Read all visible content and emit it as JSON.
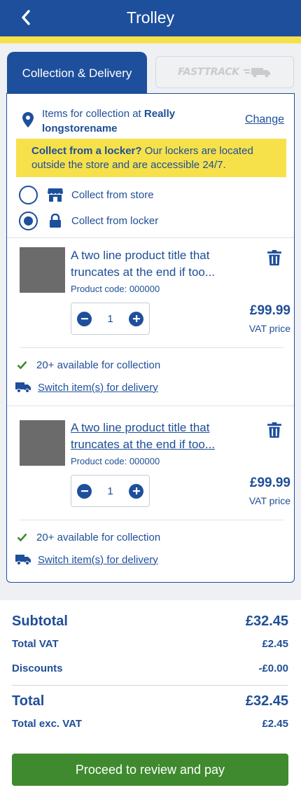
{
  "header": {
    "title": "Trolley"
  },
  "tabs": {
    "active_label": "Collection & Delivery",
    "fast_track_label": "FASTTRACK"
  },
  "location": {
    "prefix": "Items for collection at ",
    "store_name": "Really longstorename",
    "change_label": "Change"
  },
  "locker_banner": {
    "bold": "Collect from a locker?",
    "text": " Our lockers are located outside the store and are accessible 24/7."
  },
  "collect_options": [
    {
      "label": "Collect from store",
      "selected": false,
      "icon": "store-icon"
    },
    {
      "label": "Collect from locker",
      "selected": true,
      "icon": "lock-icon"
    }
  ],
  "products": [
    {
      "title_line1": "A two line product title that",
      "title_line2": "truncates at the end if too...",
      "code": "Product code: 000000",
      "quantity": "1",
      "price": "£99.99",
      "price_note": "VAT price",
      "availability": "20+ available for collection",
      "switch_label": "Switch item(s) for delivery"
    },
    {
      "title_line1": "A two line product title that",
      "title_line2": "truncates at the end if too...",
      "code": "Product code: 000000",
      "quantity": "1",
      "price": "£99.99",
      "price_note": "VAT price",
      "availability": "20+ available for collection",
      "switch_label": "Switch item(s) for delivery"
    }
  ],
  "summary": {
    "subtotal_label": "Subtotal",
    "subtotal_value": "£32.45",
    "vat_label": "Total VAT",
    "vat_value": "£2.45",
    "discounts_label": "Discounts",
    "discounts_value": "-£0.00",
    "total_label": "Total",
    "total_value": "£32.45",
    "total_exc_label": "Total exc. VAT",
    "total_exc_value": "£2.45"
  },
  "proceed_label": "Proceed to review and pay",
  "colors": {
    "brand_blue": "#1d4f9c",
    "accent_yellow": "#f6e14b",
    "success_green": "#3f8a2e"
  }
}
